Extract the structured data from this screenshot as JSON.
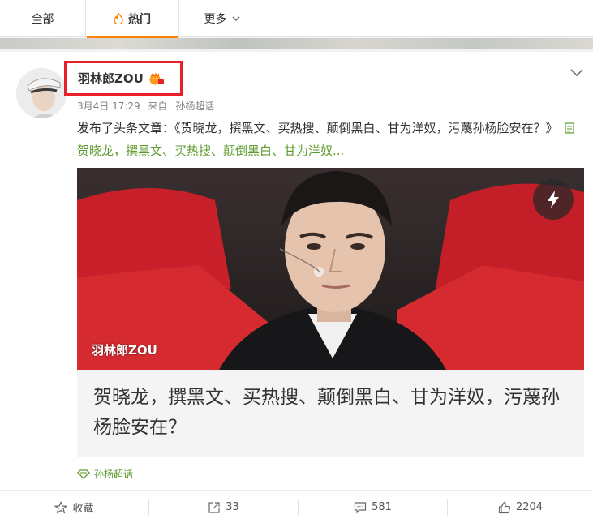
{
  "tabs": {
    "all": "全部",
    "hot": "热门",
    "more": "更多"
  },
  "post": {
    "author": "羽林郎ZOU",
    "date": "3月4日 17:29",
    "source_prefix": "来自",
    "source": "孙杨超话",
    "text": "发布了头条文章：《贺晓龙，撰黑文、买热搜、颠倒黑白、甘为洋奴，污蔑孙杨脸安在？》",
    "article_link": "贺晓龙，撰黑文、买热搜、颠倒黑白、甘为洋奴...",
    "watermark": "羽林郎ZOU",
    "article_title": "贺晓龙，撰黑文、买热搜、颠倒黑白、甘为洋奴，污蔑孙杨脸安在？",
    "topic_tag": "孙杨超话"
  },
  "actions": {
    "favorite": "收藏",
    "forward_count": "33",
    "comment_count": "581",
    "like_count": "2204"
  },
  "colors": {
    "accent": "#ff8200",
    "link_green": "#5d9b2c",
    "highlight_box": "#e8202a"
  }
}
